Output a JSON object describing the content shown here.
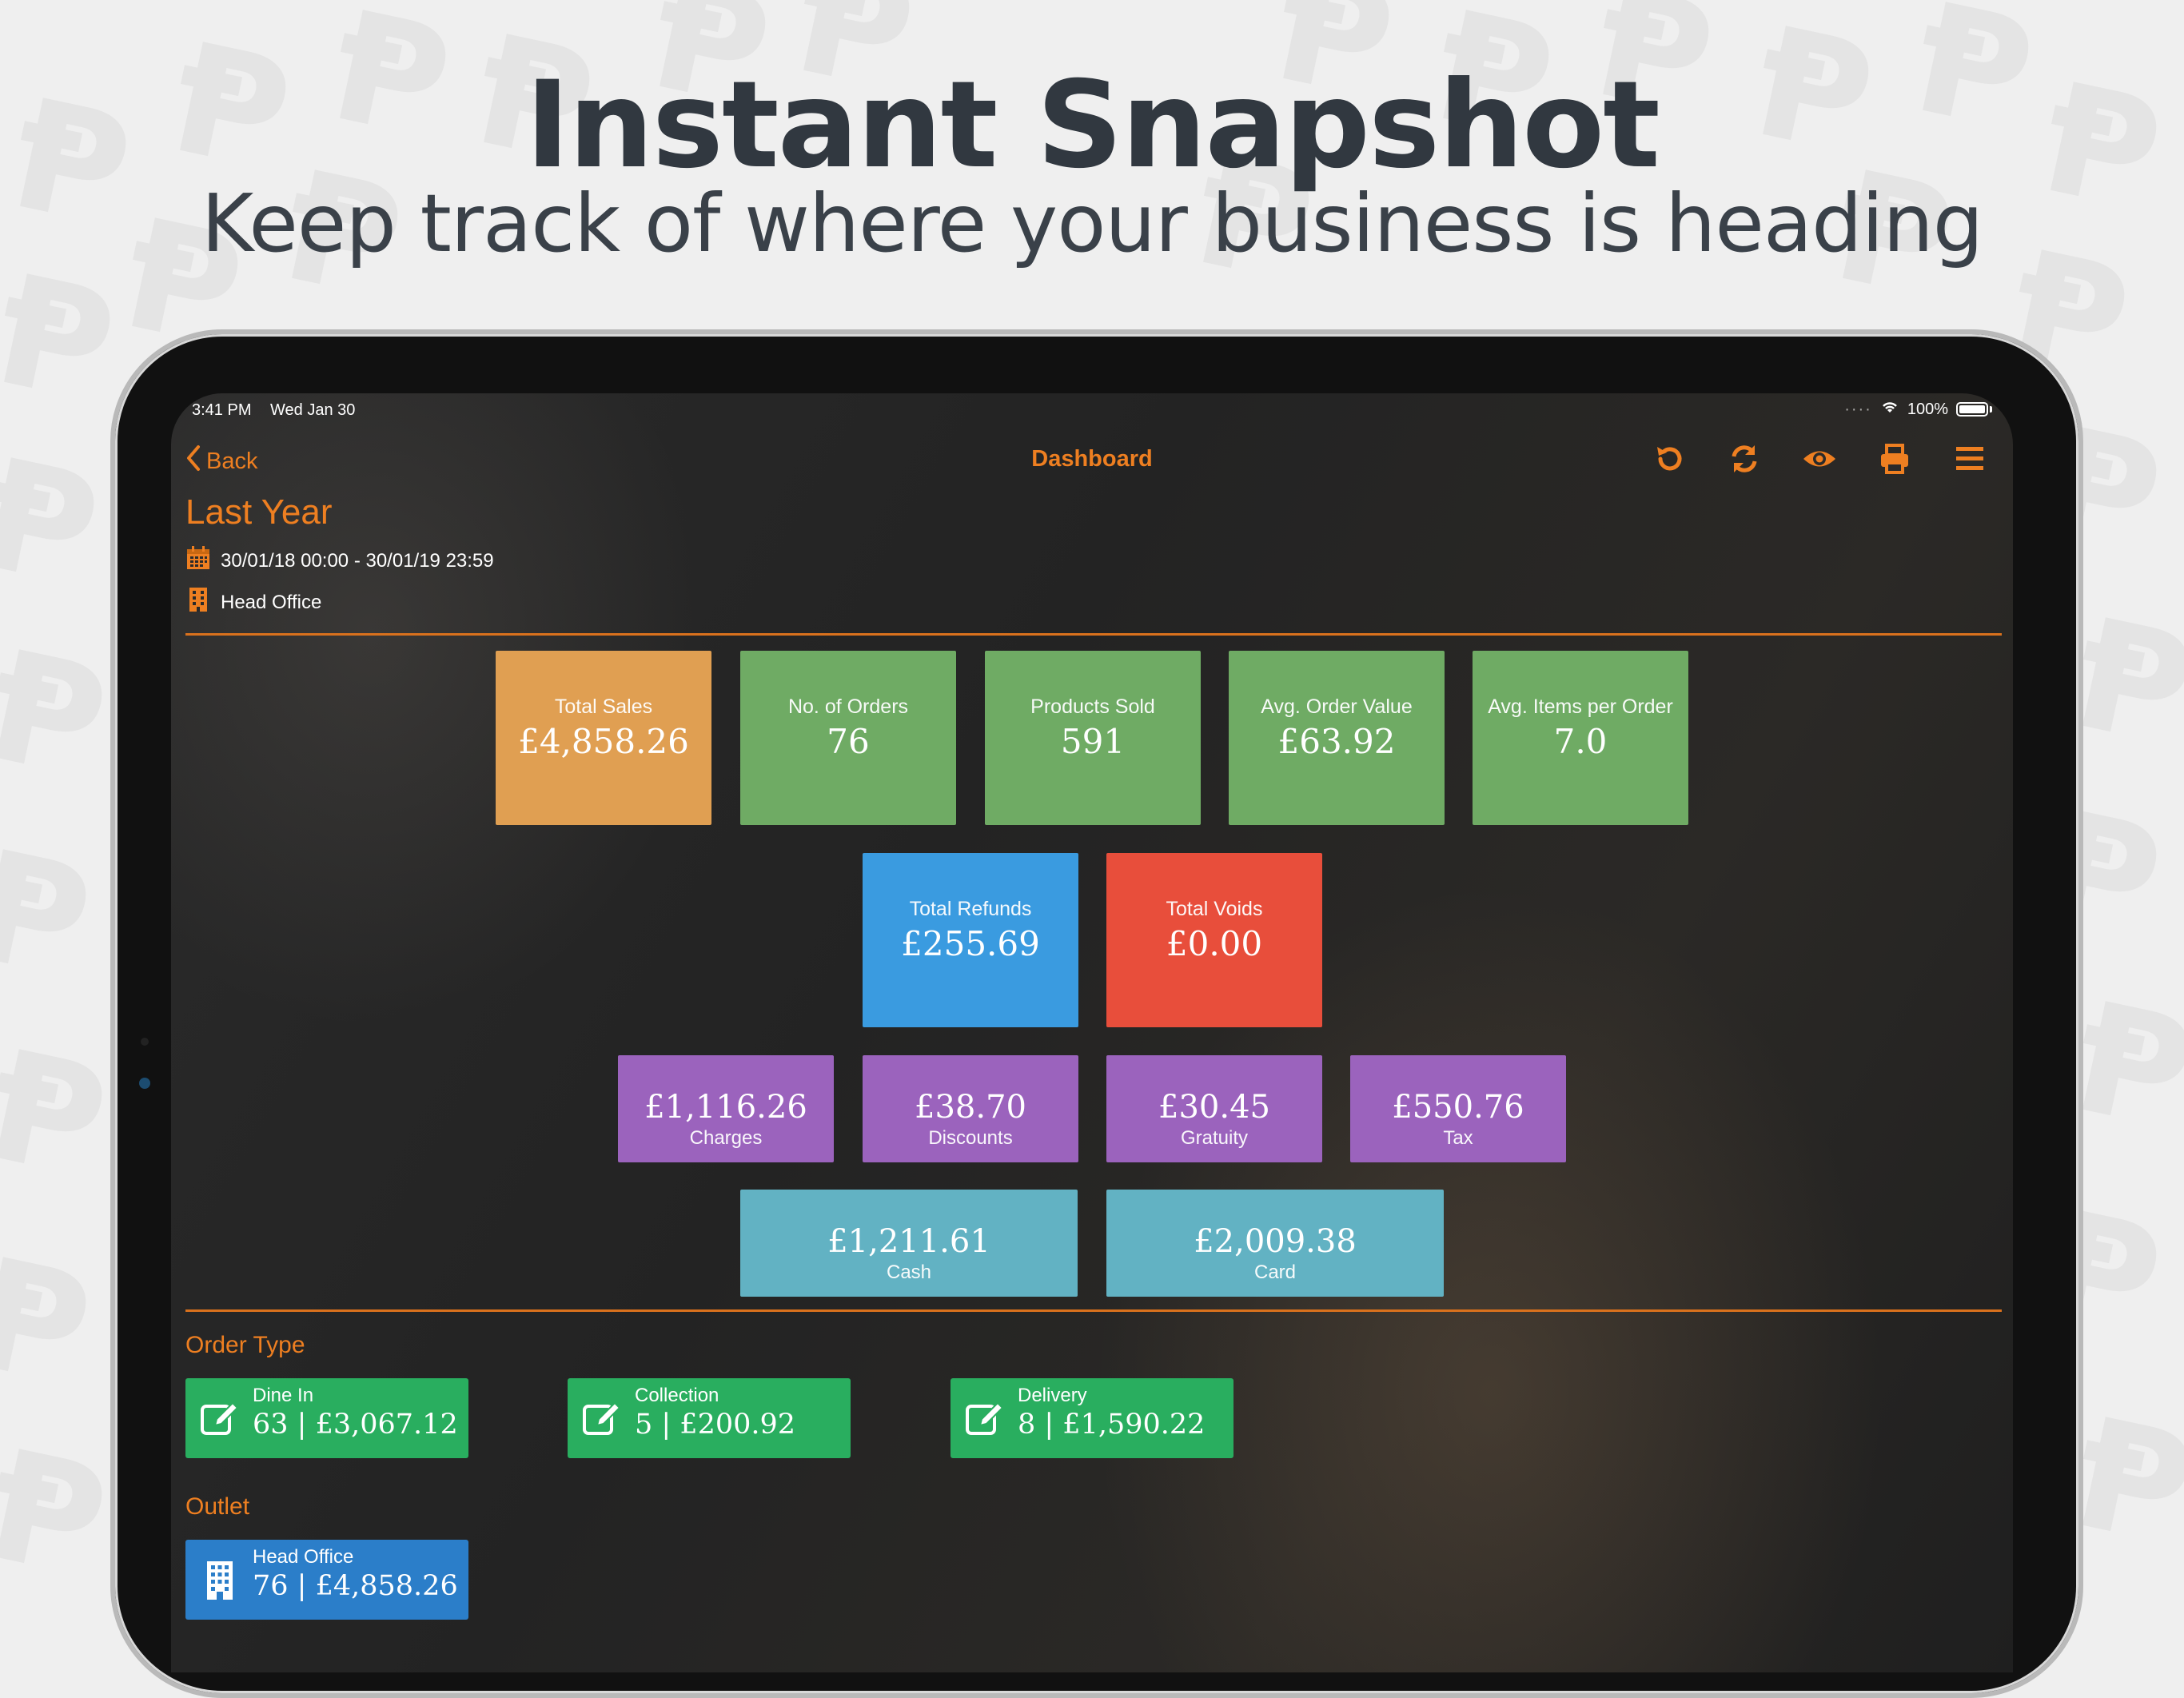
{
  "hero": {
    "title": "Instant Snapshot",
    "subtitle": "Keep track of where your business is heading"
  },
  "status_bar": {
    "time": "3:41 PM",
    "date": "Wed Jan 30",
    "battery": "100%"
  },
  "nav": {
    "back_label": "Back",
    "title": "Dashboard",
    "icons": [
      "undo-icon",
      "refresh-icon",
      "eye-icon",
      "print-icon",
      "menu-icon"
    ]
  },
  "header": {
    "period": "Last Year",
    "date_range": "30/01/18 00:00 - 30/01/19 23:59",
    "location": "Head Office"
  },
  "kpis": [
    {
      "label": "Total Sales",
      "value": "£4,858.26",
      "color": "#e09f52"
    },
    {
      "label": "No. of Orders",
      "value": "76",
      "color": "#6fab64"
    },
    {
      "label": "Products Sold",
      "value": "591",
      "color": "#6fab64"
    },
    {
      "label": "Avg. Order Value",
      "value": "£63.92",
      "color": "#6fab64"
    },
    {
      "label": "Avg. Items per Order",
      "value": "7.0",
      "color": "#6fab64"
    }
  ],
  "adjustments": [
    {
      "label": "Total Refunds",
      "value": "£255.69",
      "color": "#3a9be0"
    },
    {
      "label": "Total Voids",
      "value": "£0.00",
      "color": "#e84e3b"
    }
  ],
  "extras": [
    {
      "value": "£1,116.26",
      "label": "Charges"
    },
    {
      "value": "£38.70",
      "label": "Discounts"
    },
    {
      "value": "£30.45",
      "label": "Gratuity"
    },
    {
      "value": "£550.76",
      "label": "Tax"
    }
  ],
  "payments": [
    {
      "value": "£1,211.61",
      "label": "Cash"
    },
    {
      "value": "£2,009.38",
      "label": "Card"
    }
  ],
  "order_type": {
    "section_label": "Order Type",
    "items": [
      {
        "title": "Dine In",
        "value": "63 | £3,067.12"
      },
      {
        "title": "Collection",
        "value": "5 | £200.92"
      },
      {
        "title": "Delivery",
        "value": "8 | £1,590.22"
      }
    ]
  },
  "outlet": {
    "section_label": "Outlet",
    "items": [
      {
        "title": "Head Office",
        "value": "76 | £4,858.26"
      }
    ]
  },
  "colors": {
    "accent": "#ee7f21",
    "total_sales": "#e09f52",
    "kpi_green": "#6fab64",
    "refunds": "#3a9be0",
    "voids": "#e84e3b",
    "extras_purple": "#9b63bd",
    "payments_teal": "#62b2c3",
    "order_type_green": "#29ae5f",
    "outlet_blue": "#2b7ec9"
  }
}
